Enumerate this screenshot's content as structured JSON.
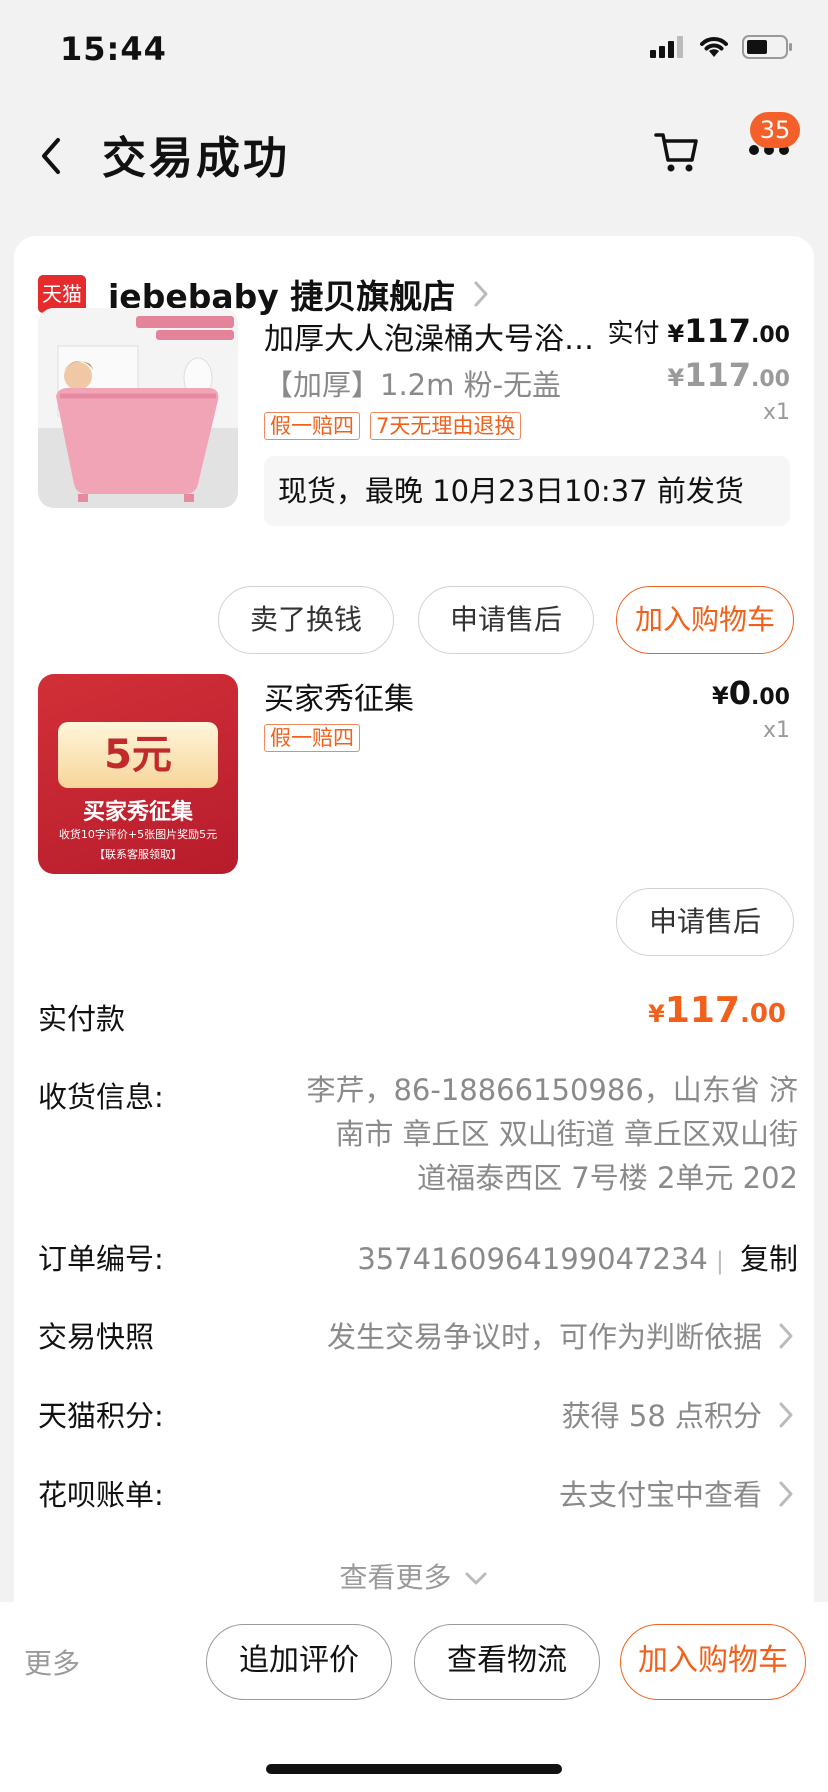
{
  "status_bar": {
    "time": "15:44"
  },
  "nav": {
    "title": "交易成功",
    "cart_badge": "35"
  },
  "shop": {
    "logo_text": "天猫",
    "name": "jebebaby 捷贝旗舰店"
  },
  "item1": {
    "title": "加厚大人泡澡桶大号浴…",
    "spec": "【加厚】1.2m 粉-无盖",
    "tags": [
      "假一赔四",
      "7天无理由退换"
    ],
    "paid_label": "实付",
    "paid_yen": "¥",
    "paid_int": "117",
    "paid_dec": ".00",
    "orig_yen": "¥",
    "orig_int": "117",
    "orig_dec": ".00",
    "qty": "x1",
    "shipping": "现货，最晚 10月23日10:37 前发货",
    "buttons": {
      "sell": "卖了换钱",
      "after_sale": "申请售后",
      "add_cart": "加入购物车"
    }
  },
  "item2": {
    "title": "买家秀征集",
    "tag": "假一赔四",
    "price_yen": "¥",
    "price_int": "0",
    "price_dec": ".00",
    "qty": "x1",
    "promo": {
      "amount": "5元",
      "line1": "买家秀征集",
      "line2": "收货10字评价+5张图片奖励5元",
      "line3": "【联系客服领取】"
    },
    "after_sale": "申请售后"
  },
  "order": {
    "total_label": "实付款",
    "total_yen": "¥",
    "total_int": "117",
    "total_dec": ".00",
    "address_label": "收货信息:",
    "address_lines": [
      "李芹，86-18866150986，山东省 济",
      "南市 章丘区 双山街道 章丘区双山街",
      "道福泰西区 7号楼 2单元 202"
    ],
    "order_no_label": "订单编号:",
    "order_no": "3574160964199047234",
    "order_sep": "|",
    "copy": "复制",
    "snapshot_label": "交易快照",
    "snapshot_value": "发生交易争议时，可作为判断依据",
    "points_label": "天猫积分:",
    "points_value": "获得 58 点积分",
    "huabei_label": "花呗账单:",
    "huabei_value": "去支付宝中查看",
    "see_more": "查看更多"
  },
  "bottom_bar": {
    "more": "更多",
    "review": "追加评价",
    "logistics": "查看物流",
    "add_cart": "加入购物车"
  },
  "colors": {
    "accent": "#f2611c",
    "badge": "#f5602a",
    "tmall_red": "#e52b2b"
  }
}
